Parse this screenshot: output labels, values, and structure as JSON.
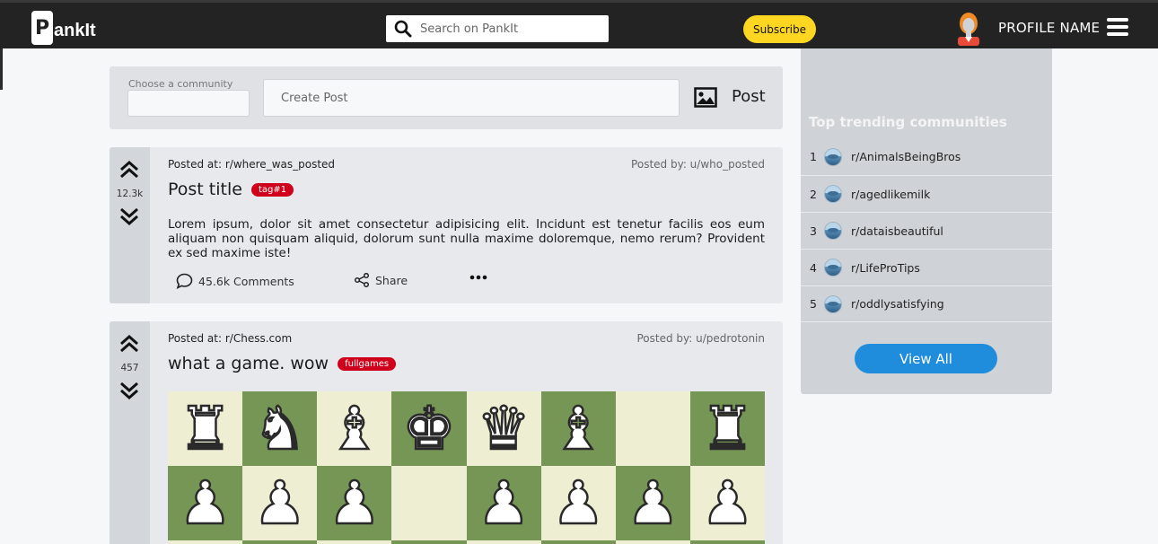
{
  "header": {
    "logo_letter": "P",
    "logo_text": "ankIt",
    "search_placeholder": "Search on PankIt",
    "subscribe_label": "Subscribe",
    "profile_name": "PROFILE NAME"
  },
  "create_post": {
    "community_label": "Choose a community",
    "input_placeholder": "Create Post",
    "post_label": "Post"
  },
  "posts": [
    {
      "votes": "12.3k",
      "posted_at_label": "Posted at:",
      "posted_at": "r/where_was_posted",
      "posted_by": "Posted by: u/who_posted",
      "title": "Post title",
      "tag": "tag#1",
      "body": "Lorem ipsum, dolor sit amet consectetur adipisicing elit. Incidunt est tenetur facilis eos eum aliquam non quisquam aliquid, dolorum sunt nulla maxime doloremque, nemo rerum? Provident ex sed maxime iste!",
      "comments": "45.6k Comments",
      "share": "Share"
    },
    {
      "votes": "457",
      "posted_at_label": "Posted at:",
      "posted_at": "r/Chess.com",
      "posted_by": "Posted by: u/pedrotonin",
      "title": "what a game. wow",
      "tag": "fullgames"
    }
  ],
  "sidebar": {
    "title": "Top trending communities",
    "communities": [
      {
        "rank": "1",
        "name": "r/AnimalsBeingBros"
      },
      {
        "rank": "2",
        "name": "r/agedlikemilk"
      },
      {
        "rank": "3",
        "name": "r/dataisbeautiful"
      },
      {
        "rank": "4",
        "name": "r/LifeProTips"
      },
      {
        "rank": "5",
        "name": "r/oddlysatisfying"
      }
    ],
    "view_all_label": "View All"
  },
  "colors": {
    "header_bg": "#232323",
    "accent_yellow": "#fdd622",
    "accent_blue": "#1f8ddb",
    "tag_red": "#d0021b",
    "board_light": "#eeeed2",
    "board_dark": "#769656"
  },
  "icons": [
    "search-icon",
    "image-icon",
    "upvote-icon",
    "downvote-icon",
    "comment-icon",
    "share-icon",
    "more-icon",
    "menu-icon",
    "avatar-icon"
  ]
}
